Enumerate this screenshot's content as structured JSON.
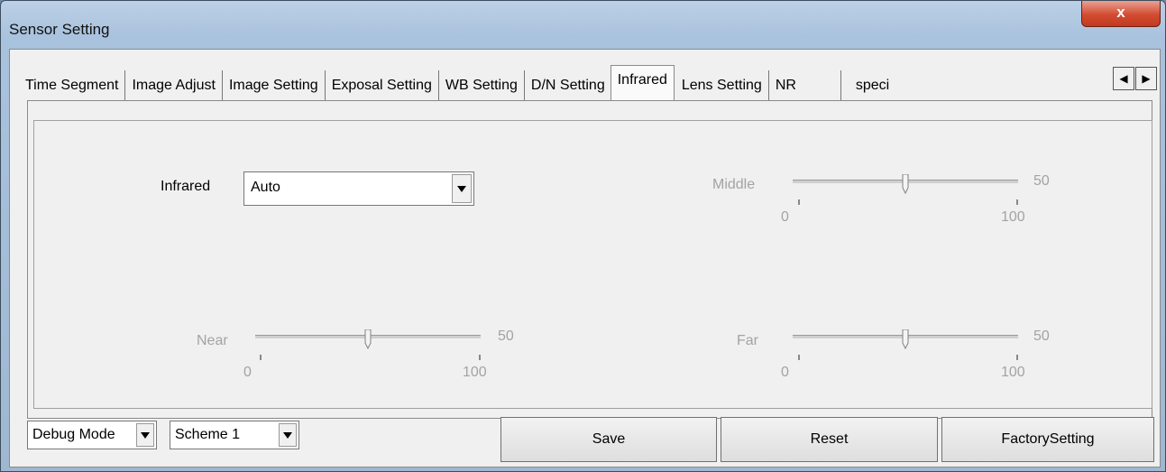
{
  "window": {
    "title": "Sensor Setting",
    "close_label": "x"
  },
  "tabs": [
    {
      "label": "Time Segment"
    },
    {
      "label": "Image Adjust"
    },
    {
      "label": "Image Setting"
    },
    {
      "label": "Exposal Setting"
    },
    {
      "label": "WB Setting"
    },
    {
      "label": "D/N Setting"
    },
    {
      "label": "Infrared",
      "active": true
    },
    {
      "label": "Lens Setting"
    },
    {
      "label": "NR"
    },
    {
      "label": "speci"
    }
  ],
  "tab_scroll": {
    "left": "◀",
    "right": "▶"
  },
  "infrared": {
    "label": "Infrared",
    "value": "Auto"
  },
  "sliders": {
    "middle": {
      "label": "Middle",
      "value": "50",
      "min": "0",
      "max": "100",
      "level": 0.5
    },
    "near": {
      "label": "Near",
      "value": "50",
      "min": "0",
      "max": "100",
      "level": 0.5
    },
    "far": {
      "label": "Far",
      "value": "50",
      "min": "0",
      "max": "100",
      "level": 0.5
    }
  },
  "footer": {
    "mode": "Debug Mode",
    "scheme": "Scheme 1",
    "save": "Save",
    "reset": "Reset",
    "factory": "FactorySetting"
  }
}
